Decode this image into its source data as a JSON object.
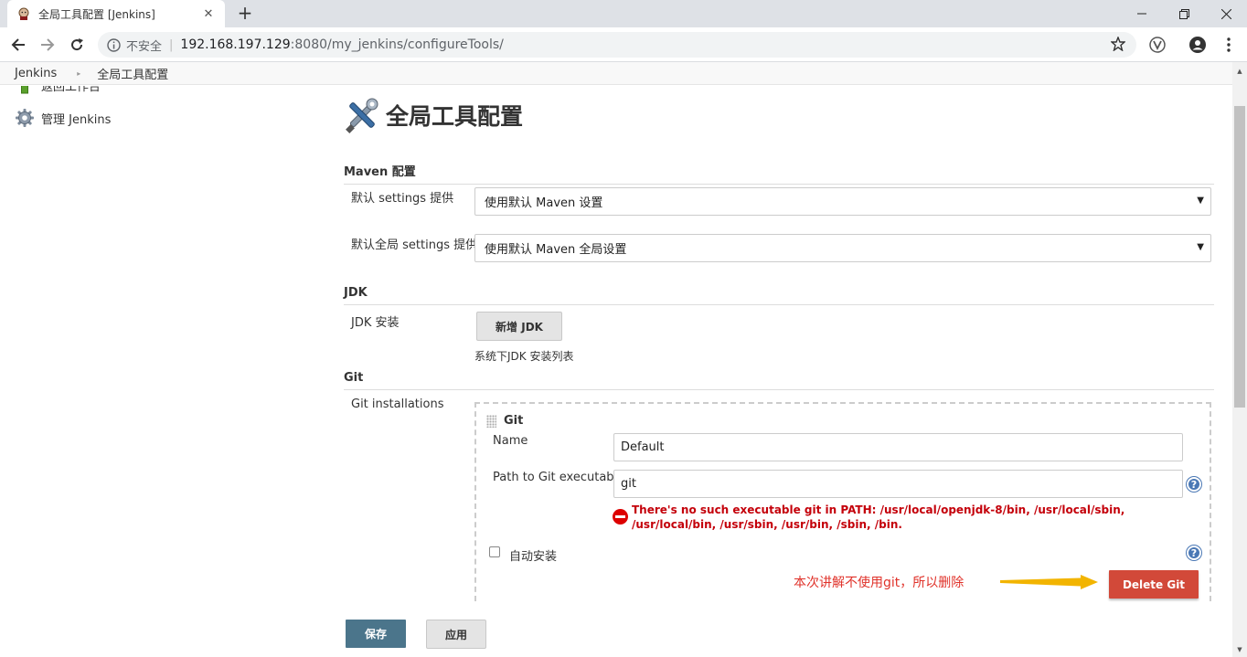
{
  "browser": {
    "tab_title": "全局工具配置 [Jenkins]",
    "tab_close": "✕",
    "new_tab": "+",
    "security_label": "不安全",
    "url_separator": "|",
    "url_host": "192.168.197.129",
    "url_path": ":8080/my_jenkins/configureTools/"
  },
  "breadcrumbs": {
    "items": [
      "Jenkins",
      "全局工具配置"
    ],
    "separator": "▸"
  },
  "sidebar": {
    "items": [
      {
        "label": "返回工作台",
        "icon": "up-arrow-icon"
      },
      {
        "label": "管理 Jenkins",
        "icon": "gear-icon"
      }
    ]
  },
  "page": {
    "title": "全局工具配置",
    "icon": "tools-icon"
  },
  "maven": {
    "section": "Maven 配置",
    "settings_label": "默认 settings 提供",
    "settings_value": "使用默认 Maven 设置",
    "global_settings_label": "默认全局 settings 提供",
    "global_settings_value": "使用默认 Maven 全局设置"
  },
  "jdk": {
    "section": "JDK",
    "install_label": "JDK 安装",
    "add_button": "新增 JDK",
    "hint": "系统下JDK 安装列表"
  },
  "git": {
    "section": "Git",
    "installations_label": "Git installations",
    "block_title": "Git",
    "name_label": "Name",
    "name_value": "Default",
    "path_label": "Path to Git executable",
    "path_value": "git",
    "error": "There's no such executable git in PATH: /usr/local/openjdk-8/bin, /usr/local/sbin, /usr/local/bin, /usr/sbin, /usr/bin, /sbin, /bin.",
    "auto_install_label": "自动安装",
    "auto_install_checked": false,
    "annotation": "本次讲解不使用git，所以删除",
    "delete_button": "Delete Git",
    "help_glyph": "?"
  },
  "footer": {
    "save_button": "保存",
    "apply_button": "应用"
  },
  "colors": {
    "annotation_red": "#e0322a",
    "arrow_yellow": "#f2b400",
    "delete_red": "#d24939",
    "save_blue": "#4b758b",
    "error_red": "#c4000a"
  }
}
